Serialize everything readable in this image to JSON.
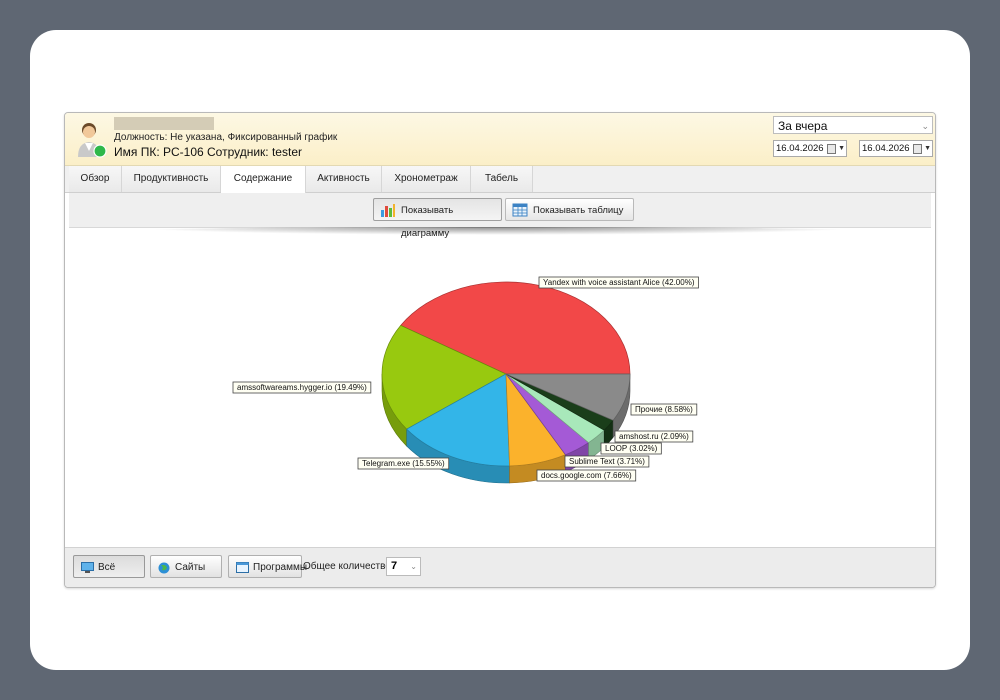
{
  "header": {
    "position_line": "Должность: Не указана, Фиксированный график",
    "pc_line": "Имя ПК: PC-106 Сотрудник: tester",
    "period": "За вчера",
    "date_from": "16.04.2026",
    "date_to": "16.04.2026"
  },
  "tabs": [
    {
      "label": "Обзор"
    },
    {
      "label": "Продуктивность"
    },
    {
      "label": "Содержание",
      "active": true
    },
    {
      "label": "Активность"
    },
    {
      "label": "Хронометраж"
    },
    {
      "label": "Табель"
    }
  ],
  "toolbar": {
    "show_chart": "Показывать диаграмму",
    "show_table": "Показывать таблицу"
  },
  "chart_data": {
    "type": "pie",
    "slices": [
      {
        "label": "Yandex with voice assistant Alice (42.00%)",
        "value": 42.0,
        "color": "#f24848"
      },
      {
        "label": "amssoftwareams.hygger.io (19.49%)",
        "value": 19.49,
        "color": "#98c90f"
      },
      {
        "label": "Telegram.exe (15.55%)",
        "value": 15.55,
        "color": "#33b5e8"
      },
      {
        "label": "docs.google.com (7.66%)",
        "value": 7.66,
        "color": "#fbb22c"
      },
      {
        "label": "Sublime Text (3.71%)",
        "value": 3.71,
        "color": "#a45ad6"
      },
      {
        "label": "LOOP (3.02%)",
        "value": 3.02,
        "color": "#a8e8ba"
      },
      {
        "label": "amshost.ru (2.09%)",
        "value": 2.09,
        "color": "#1a3e1a"
      },
      {
        "label": "Прочие (8.58%)",
        "value": 8.58,
        "color": "#8a8a8a"
      }
    ]
  },
  "bottom": {
    "all_label": "Всё",
    "sites_label": "Сайты",
    "programs_label": "Программы",
    "total_label": "Общее количество:",
    "total_value": "7"
  }
}
